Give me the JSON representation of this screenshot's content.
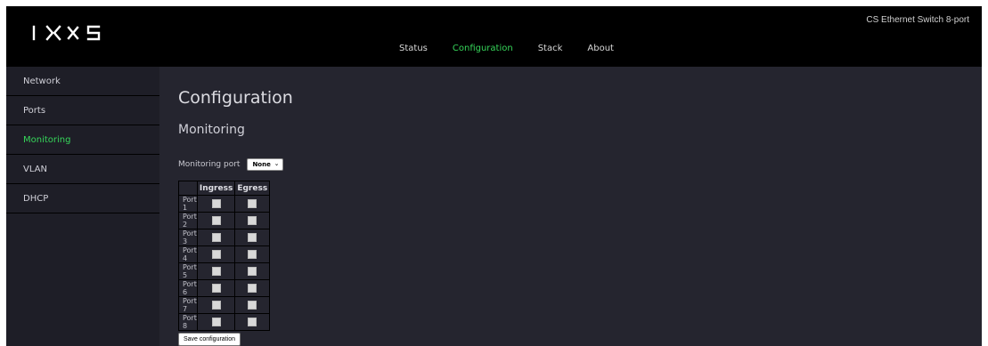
{
  "header": {
    "product_name": "CS Ethernet Switch 8-port",
    "nav": [
      {
        "label": "Status",
        "active": false
      },
      {
        "label": "Configuration",
        "active": true
      },
      {
        "label": "Stack",
        "active": false
      },
      {
        "label": "About",
        "active": false
      }
    ]
  },
  "sidebar": {
    "items": [
      {
        "label": "Network",
        "active": false
      },
      {
        "label": "Ports",
        "active": false
      },
      {
        "label": "Monitoring",
        "active": true
      },
      {
        "label": "VLAN",
        "active": false
      },
      {
        "label": "DHCP",
        "active": false
      }
    ]
  },
  "main": {
    "title": "Configuration",
    "section_title": "Monitoring",
    "monitoring_port_label": "Monitoring port",
    "monitoring_port_value": "None",
    "table": {
      "columns": [
        "",
        "Ingress",
        "Egress"
      ],
      "rows": [
        "Port 1",
        "Port 2",
        "Port 3",
        "Port 4",
        "Port 5",
        "Port 6",
        "Port 7",
        "Port 8"
      ]
    },
    "save_label": "Save configuration"
  },
  "colors": {
    "accent": "#36d65a",
    "background": "#25252f",
    "sidebar": "#1e1e27",
    "topbar": "#000000"
  },
  "icons": [
    "ixxs-logo",
    "chevron-down-icon"
  ]
}
